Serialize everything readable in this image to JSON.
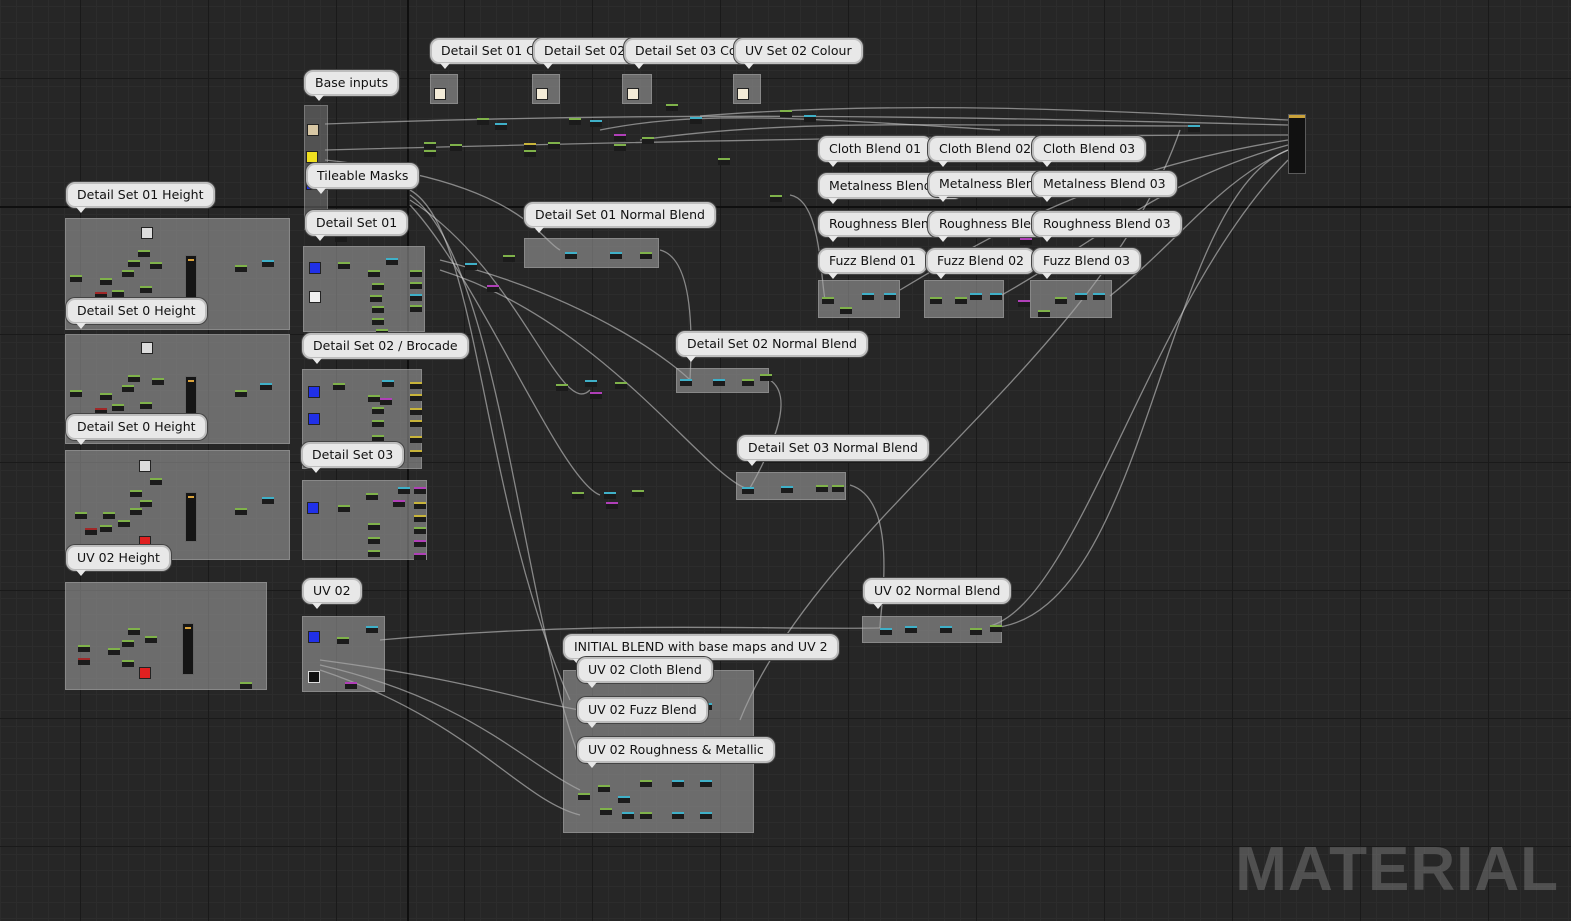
{
  "comments": {
    "detail_set_01_colour": "Detail Set 01 Colour",
    "detail_set_02_colour": "Detail Set 02 Colour",
    "detail_set_03_colour": "Detail Set 03 Colour",
    "uv_set_02_colour": "UV Set 02 Colour",
    "base_inputs": "Base inputs",
    "tileable_masks": "Tileable Masks",
    "detail_set_01": "Detail Set 01",
    "detail_set_01_height": "Detail Set 01 Height",
    "detail_set_02_height": "Detail Set 0 Height",
    "detail_set_03_height": "Detail Set 0 Height",
    "uv_02_height": "UV 02 Height",
    "detail_set_02_brocade": "Detail Set 02 / Brocade",
    "detail_set_03": "Detail Set 03",
    "uv_02": "UV 02",
    "detail_set_01_normal_blend": "Detail Set 01 Normal Blend",
    "detail_set_02_normal_blend": "Detail Set 02 Normal Blend",
    "detail_set_03_normal_blend": "Detail Set 03 Normal Blend",
    "uv_02_normal_blend": "UV 02 Normal Blend",
    "initial_blend": "INITIAL BLEND with base maps and UV 2",
    "uv_02_cloth_blend": "UV 02 Cloth Blend",
    "uv_02_fuzz_blend": "UV 02 Fuzz Blend",
    "uv_02_roughness_metallic": "UV 02 Roughness & Metallic",
    "cloth_blend_01": "Cloth Blend 01",
    "cloth_blend_02": "Cloth Blend 02",
    "cloth_blend_03": "Cloth Blend 03",
    "metalness_blend_01": "Metalness Blend 01",
    "metalness_blend_02": "Metalness Blend 02",
    "metalness_blend_03": "Metalness Blend 03",
    "roughness_blend_01": "Roughness Blend 01",
    "roughness_blend_02": "Roughness Blend 02",
    "roughness_blend_03": "Roughness Blend 03",
    "fuzz_blend_01": "Fuzz Blend 01",
    "fuzz_blend_02": "Fuzz Blend 02",
    "fuzz_blend_03": "Fuzz Blend 03"
  },
  "watermark": "MATERIAL",
  "colors": {
    "graph_background": "#262626",
    "comment_bubble": "#e8e8e8",
    "result_node_header": "#caa23a",
    "pin_float": "#7fb24a",
    "pin_texture": "#3fb0c8",
    "pin_param": "#b03fb8",
    "mask_red": "#e02020",
    "mask_blue": "#2030e8",
    "mask_yellow": "#f0e020"
  }
}
